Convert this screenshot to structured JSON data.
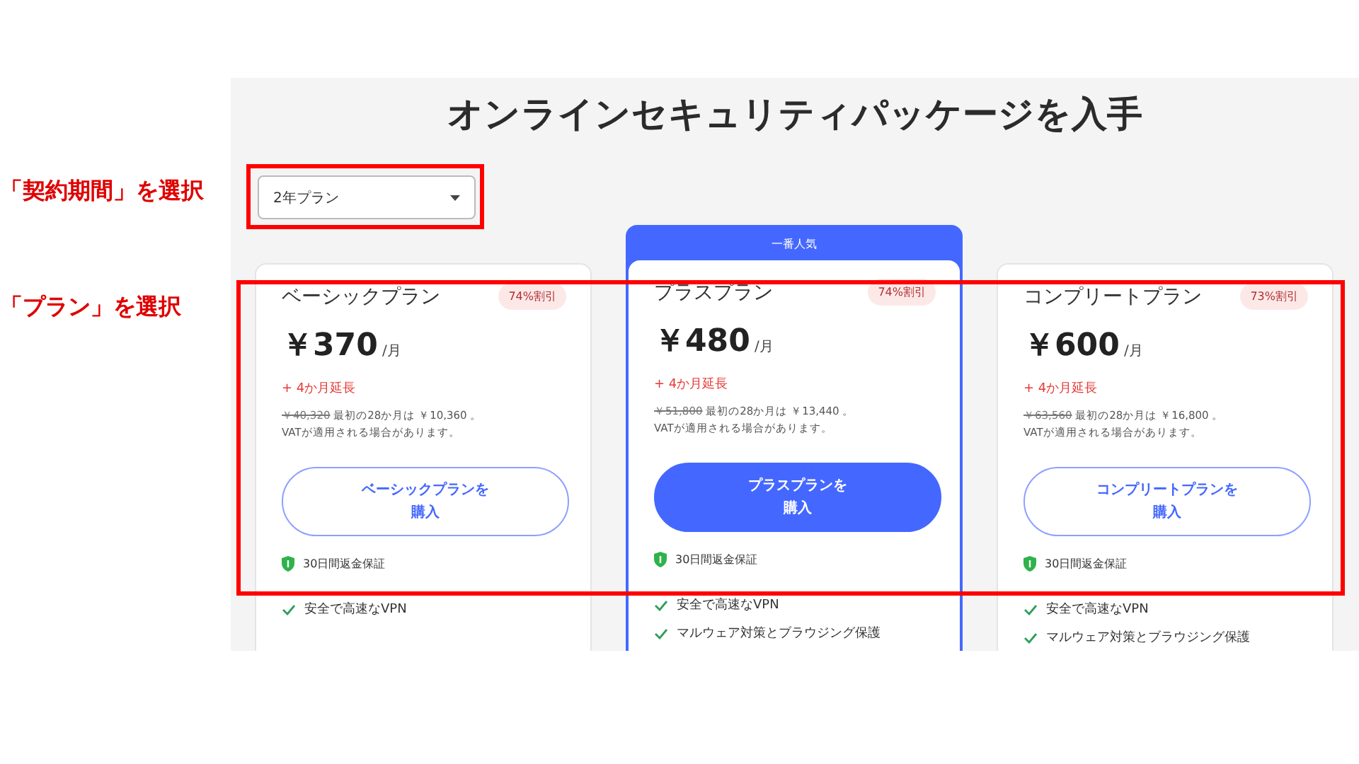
{
  "annotations": [
    {
      "text": "「契約期間」を選択"
    },
    {
      "text": "「プラン」を選択"
    }
  ],
  "heading": "オンラインセキュリティパッケージを入手",
  "period_select": {
    "value": "2年プラン"
  },
  "plans": [
    {
      "name": "ベーシックプラン",
      "discount": "74%割引",
      "price": "￥370",
      "unit": "/月",
      "bonus": "+ 4か月延長",
      "original_price": "￥40,320",
      "billing": "最初の28か月は ￥10,360 。",
      "vat_note": "VATが適用される場合があります。",
      "button": "ベーシックプランを購入",
      "featured": false,
      "guarantee": "30日間返金保証",
      "features": [
        "安全で高速なVPN"
      ]
    },
    {
      "name": "プラスプラン",
      "discount": "74%割引",
      "price": "￥480",
      "unit": "/月",
      "bonus": "+ 4か月延長",
      "original_price": "￥51,800",
      "billing": "最初の28か月は ￥13,440 。",
      "vat_note": "VATが適用される場合があります。",
      "button": "プラスプランを購入",
      "featured": true,
      "featured_label": "一番人気",
      "guarantee": "30日間返金保証",
      "features": [
        "安全で高速なVPN",
        "マルウェア対策とブラウジング保護"
      ]
    },
    {
      "name": "コンプリートプラン",
      "discount": "73%割引",
      "price": "￥600",
      "unit": "/月",
      "bonus": "+ 4か月延長",
      "original_price": "￥63,560",
      "billing": "最初の28か月は ￥16,800 。",
      "vat_note": "VATが適用される場合があります。",
      "button": "コンプリートプランを購入",
      "featured": false,
      "guarantee": "30日間返金保証",
      "features": [
        "安全で高速なVPN",
        "マルウェア対策とブラウジング保護"
      ]
    }
  ]
}
